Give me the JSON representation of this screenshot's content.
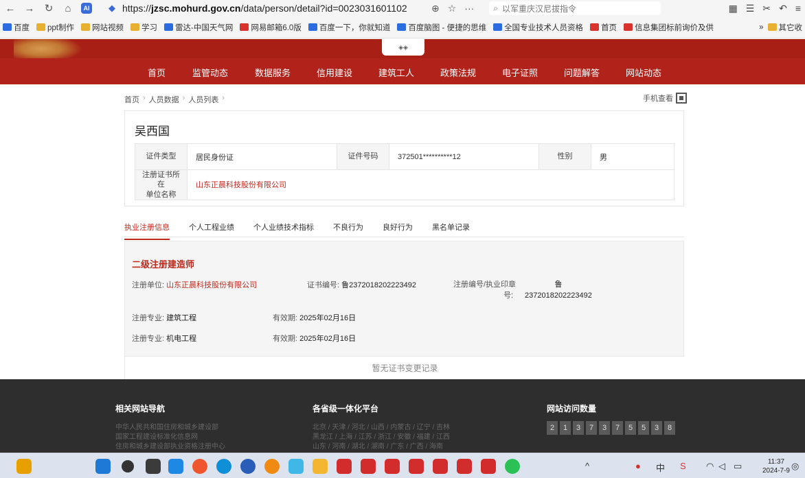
{
  "browser": {
    "url": "https://jzsc.mohurd.gov.cn/data/person/detail?id=0023031601102",
    "url_host": "jzsc.mohurd.gov.cn",
    "url_prefix": "https://",
    "url_suffix": "/data/person/detail?id=0023031601102",
    "search_placeholder": "以军重庆汉尼拔指令",
    "bookmarks": [
      "百度",
      "ppt制作",
      "网站视频",
      "学习",
      "雷达-中国天气网",
      "网易邮箱6.0版",
      "百度一下，你就知道",
      "百度脑图 - 便捷的思维",
      "全国专业技术人员资格",
      "首页",
      "信息集团标前询价及供",
      "其它收"
    ]
  },
  "site": {
    "nav": [
      "首页",
      "监管动态",
      "数据服务",
      "信用建设",
      "建筑工人",
      "政策法规",
      "电子证照",
      "问题解答",
      "网站动态"
    ]
  },
  "breadcrumb": [
    "首页",
    "人员数据",
    "人员列表"
  ],
  "mobile_view": "手机查看",
  "person": {
    "name": "吴西国",
    "id_type_label": "证件类型",
    "id_type": "居民身份证",
    "id_no_label": "证件号码",
    "id_no": "372501**********12",
    "gender_label": "性别",
    "gender": "男",
    "unit_label_1": "注册证书所在",
    "unit_label_2": "单位名称",
    "unit": "山东正晨科技股份有限公司"
  },
  "tabs": [
    "执业注册信息",
    "个人工程业绩",
    "个人业绩技术指标",
    "不良行为",
    "良好行为",
    "黑名单记录"
  ],
  "cert": {
    "title": "二级注册建造师",
    "unit_label": "注册单位:",
    "unit": "山东正晨科技股份有限公司",
    "cert_no_label": "证书编号:",
    "cert_no": "鲁2372018202223492",
    "seal_label_1": "注册编号/执业印章",
    "seal_label_2": "号:",
    "seal_no_1": "鲁",
    "seal_no_2": "2372018202223492",
    "specialties": [
      {
        "label": "注册专业:",
        "value": "建筑工程",
        "valid_label": "有效期:",
        "valid": "2025年02月16日"
      },
      {
        "label": "注册专业:",
        "value": "机电工程",
        "valid_label": "有效期:",
        "valid": "2025年02月16日"
      }
    ],
    "no_change": "暂无证书变更记录"
  },
  "footer": {
    "nav_title": "相关网站导航",
    "nav_lines": [
      "中华人民共和国住房和城乡建设部",
      "国家工程建设标准化信息网",
      "住房和城乡建设部执业资格注册中心"
    ],
    "platform_title": "各省级一体化平台",
    "platform_lines": [
      "北京 / 天津 / 河北 / 山西 / 内蒙古 / 辽宁 / 吉林",
      "黑龙江 / 上海 / 江苏 / 浙江 / 安徽 / 福建 / 江西",
      "山东 / 河南 / 湖北 / 湖南 / 广东 / 广西 / 海南"
    ],
    "visits_title": "网站访问数量",
    "visits": [
      "2",
      "1",
      "3",
      "7",
      "3",
      "7",
      "5",
      "5",
      "3",
      "8"
    ]
  },
  "taskbar": {
    "time": "11:37",
    "date": "2024-7-9",
    "ime": "中"
  }
}
